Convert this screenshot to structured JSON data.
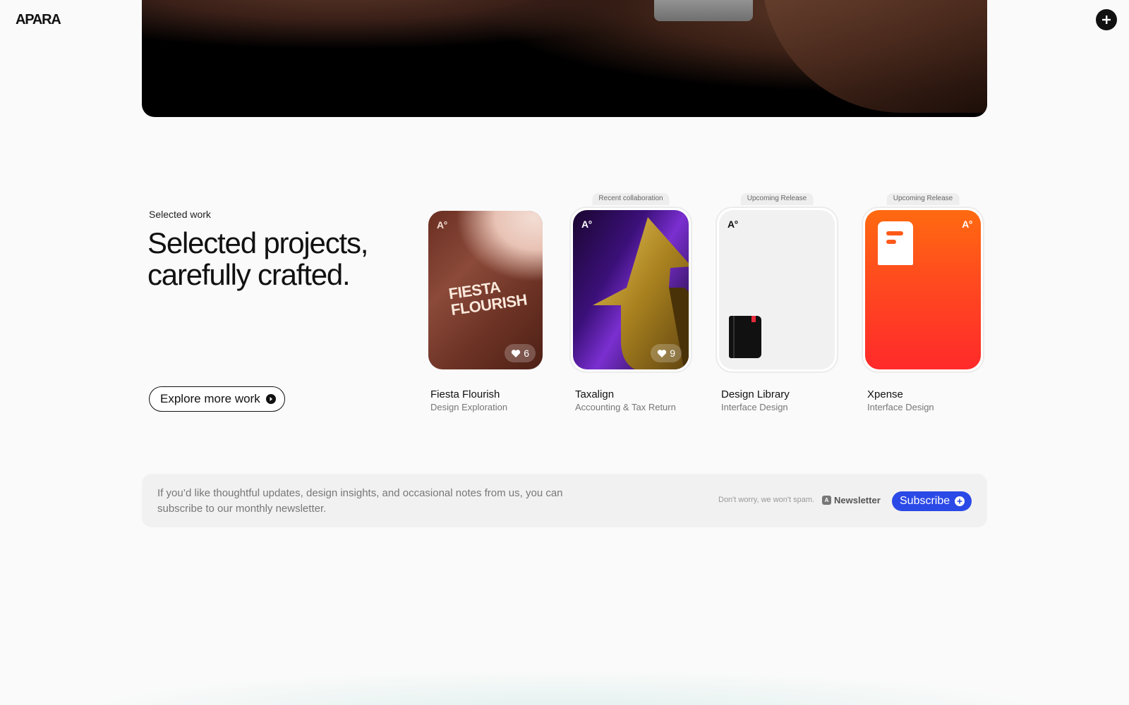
{
  "header": {
    "logo": "APARA",
    "plus_icon": "plus-icon"
  },
  "hero": {
    "image": "hero-photo-arm-with-watch-strap"
  },
  "selected": {
    "eyebrow": "Selected work",
    "headline": "Selected projects, carefully crafted.",
    "explore_label": "Explore more work",
    "explore_icon": "arrow-right-circle-icon"
  },
  "projects": [
    {
      "title": "Fiesta Flourish",
      "subtitle": "Design Exploration",
      "tag": "",
      "likes": "6",
      "artwork_text": "FIESTA FLOURISH"
    },
    {
      "title": "Taxalign",
      "subtitle": "Accounting & Tax Return",
      "tag": "Recent collaboration",
      "likes": "9"
    },
    {
      "title": "Design Library",
      "subtitle": "Interface Design",
      "tag": "Upcoming Release"
    },
    {
      "title": "Xpense",
      "subtitle": "Interface Design",
      "tag": "Upcoming Release"
    }
  ],
  "card_logo": "A°",
  "newsletter": {
    "message": "If you’d like thoughtful updates, design insights, and occasional notes from us, you can subscribe to our monthly newsletter.",
    "spam_note": "Don't worry, we won't spam.",
    "badge_label": "Newsletter",
    "subscribe_label": "Subscribe",
    "subscribe_icon": "plus-circle-icon"
  },
  "colors": {
    "accent": "#2b49e6",
    "background": "#fafafa"
  }
}
